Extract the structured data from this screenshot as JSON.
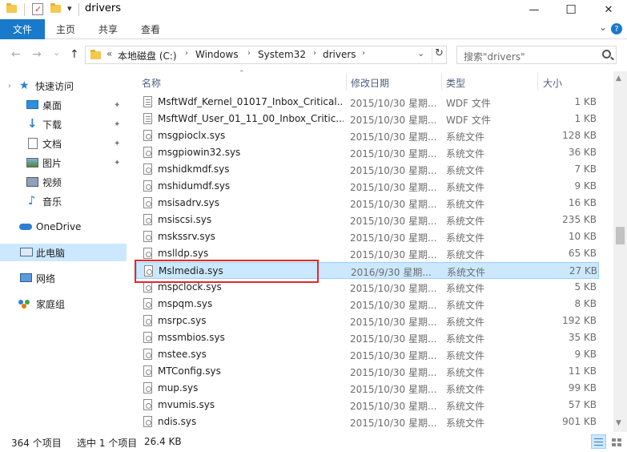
{
  "window": {
    "title": "drivers",
    "minimize_glyph": "—",
    "maximize_glyph": "☐",
    "close_glyph": "✕",
    "qa_dropdown_glyph": "▾"
  },
  "ribbon": {
    "tabs": [
      "文件",
      "主页",
      "共享",
      "查看"
    ],
    "collapse_glyph": "⌄",
    "help_glyph": "?"
  },
  "address": {
    "back_glyph": "←",
    "forward_glyph": "→",
    "recent_glyph": "⌄",
    "up_glyph": "↑",
    "overflow_glyph": "«",
    "separator_glyph": "›",
    "path": [
      "本地磁盘 (C:)",
      "Windows",
      "System32",
      "drivers"
    ],
    "dropdown_glyph": "⌄",
    "refresh_glyph": "↻",
    "search_placeholder": "搜索\"drivers\""
  },
  "navpane": {
    "quick_access": "快速访问",
    "pinned": [
      "桌面",
      "下载",
      "文档",
      "图片"
    ],
    "unpinned": [
      "视频",
      "音乐"
    ],
    "pin_glyph": "✦",
    "onedrive": "OneDrive",
    "this_pc": "此电脑",
    "network": "网络",
    "homegroup": "家庭组",
    "expander_glyph": "›"
  },
  "columns": {
    "name": "名称",
    "date": "修改日期",
    "type": "类型",
    "size": "大小",
    "sort_glyph": "⌃"
  },
  "files": [
    {
      "name": "MsftWdf_Kernel_01017_Inbox_Critical....",
      "date": "2015/10/30 星期...",
      "type": "WDF 文件",
      "size": "1 KB"
    },
    {
      "name": "MsftWdf_User_01_11_00_Inbox_Critic...",
      "date": "2015/10/30 星期...",
      "type": "WDF 文件",
      "size": "1 KB"
    },
    {
      "name": "msgpioclx.sys",
      "date": "2015/10/30 星期...",
      "type": "系统文件",
      "size": "128 KB"
    },
    {
      "name": "msgpiowin32.sys",
      "date": "2015/10/30 星期...",
      "type": "系统文件",
      "size": "36 KB"
    },
    {
      "name": "mshidkmdf.sys",
      "date": "2015/10/30 星期...",
      "type": "系统文件",
      "size": "7 KB"
    },
    {
      "name": "mshidumdf.sys",
      "date": "2015/10/30 星期...",
      "type": "系统文件",
      "size": "9 KB"
    },
    {
      "name": "msisadrv.sys",
      "date": "2015/10/30 星期...",
      "type": "系统文件",
      "size": "16 KB"
    },
    {
      "name": "msiscsi.sys",
      "date": "2015/10/30 星期...",
      "type": "系统文件",
      "size": "235 KB"
    },
    {
      "name": "mskssrv.sys",
      "date": "2015/10/30 星期...",
      "type": "系统文件",
      "size": "10 KB"
    },
    {
      "name": "mslldp.sys",
      "date": "2015/10/30 星期...",
      "type": "系统文件",
      "size": "65 KB"
    },
    {
      "name": "Mslmedia.sys",
      "date": "2016/9/30 星期...",
      "type": "系统文件",
      "size": "27 KB"
    },
    {
      "name": "mspclock.sys",
      "date": "2015/10/30 星期...",
      "type": "系统文件",
      "size": "5 KB"
    },
    {
      "name": "mspqm.sys",
      "date": "2015/10/30 星期...",
      "type": "系统文件",
      "size": "8 KB"
    },
    {
      "name": "msrpc.sys",
      "date": "2015/10/30 星期...",
      "type": "系统文件",
      "size": "192 KB"
    },
    {
      "name": "mssmbios.sys",
      "date": "2015/10/30 星期...",
      "type": "系统文件",
      "size": "35 KB"
    },
    {
      "name": "mstee.sys",
      "date": "2015/10/30 星期...",
      "type": "系统文件",
      "size": "9 KB"
    },
    {
      "name": "MTConfig.sys",
      "date": "2015/10/30 星期...",
      "type": "系统文件",
      "size": "11 KB"
    },
    {
      "name": "mup.sys",
      "date": "2015/10/30 星期...",
      "type": "系统文件",
      "size": "99 KB"
    },
    {
      "name": "mvumis.sys",
      "date": "2015/10/30 星期...",
      "type": "系统文件",
      "size": "57 KB"
    },
    {
      "name": "ndis.sys",
      "date": "2015/10/30 星期...",
      "type": "系统文件",
      "size": "901 KB"
    }
  ],
  "selected_index": 10,
  "scrollbar": {
    "up_glyph": "▲",
    "down_glyph": "▼"
  },
  "status": {
    "item_count": "364 个项目",
    "selection": "选中 1 个项目",
    "selection_size": "26.4 KB"
  },
  "colors": {
    "accent": "#1979ca",
    "selection_bg": "#cce8ff",
    "selection_border": "#99d1ff",
    "highlight_box": "#e0282a",
    "folder": "#f3c94f"
  }
}
